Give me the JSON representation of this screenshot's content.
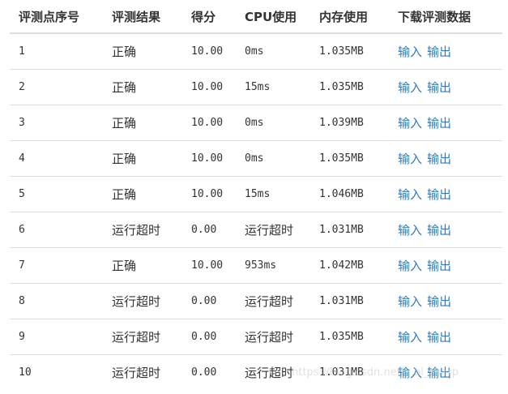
{
  "table": {
    "headers": [
      "评测点序号",
      "评测结果",
      "得分",
      "CPU使用",
      "内存使用",
      "下载评测数据"
    ],
    "rows": [
      {
        "index": "1",
        "result": "正确",
        "score": "10.00",
        "cpu": "0ms",
        "memory": "1.035MB",
        "input_link": "输入",
        "output_link": "输出"
      },
      {
        "index": "2",
        "result": "正确",
        "score": "10.00",
        "cpu": "15ms",
        "memory": "1.035MB",
        "input_link": "输入",
        "output_link": "输出"
      },
      {
        "index": "3",
        "result": "正确",
        "score": "10.00",
        "cpu": "0ms",
        "memory": "1.039MB",
        "input_link": "输入",
        "output_link": "输出"
      },
      {
        "index": "4",
        "result": "正确",
        "score": "10.00",
        "cpu": "0ms",
        "memory": "1.035MB",
        "input_link": "输入",
        "output_link": "输出"
      },
      {
        "index": "5",
        "result": "正确",
        "score": "10.00",
        "cpu": "15ms",
        "memory": "1.046MB",
        "input_link": "输入",
        "output_link": "输出"
      },
      {
        "index": "6",
        "result": "运行超时",
        "score": "0.00",
        "cpu": "运行超时",
        "memory": "1.031MB",
        "input_link": "输入",
        "output_link": "输出"
      },
      {
        "index": "7",
        "result": "正确",
        "score": "10.00",
        "cpu": "953ms",
        "memory": "1.042MB",
        "input_link": "输入",
        "output_link": "输出"
      },
      {
        "index": "8",
        "result": "运行超时",
        "score": "0.00",
        "cpu": "运行超时",
        "memory": "1.031MB",
        "input_link": "输入",
        "output_link": "输出"
      },
      {
        "index": "9",
        "result": "运行超时",
        "score": "0.00",
        "cpu": "运行超时",
        "memory": "1.035MB",
        "input_link": "输入",
        "output_link": "输出"
      },
      {
        "index": "10",
        "result": "运行超时",
        "score": "0.00",
        "cpu": "运行超时",
        "memory": "1.031MB",
        "input_link": "输入",
        "output_link": "输出"
      }
    ]
  },
  "watermark": "https://blog.csdn.net/...al_sharp",
  "colors": {
    "link": "#337ab7",
    "text": "#333333",
    "border": "#dddddd"
  }
}
